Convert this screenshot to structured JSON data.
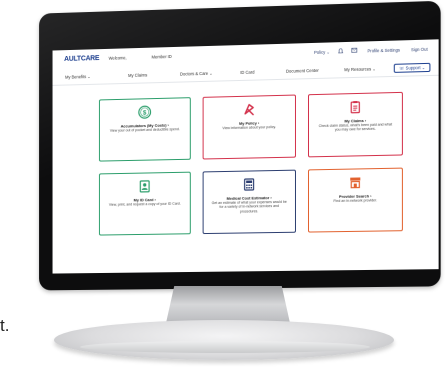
{
  "header": {
    "logo": "AULTCARE",
    "logo_tagline": "",
    "welcome": "Welcome,",
    "member_id": "Member ID",
    "policy_menu": "Policy ⌄",
    "profile_settings": "Profile & Settings",
    "sign_out": "Sign Out"
  },
  "nav": {
    "items": [
      "My Benefits ⌄",
      "My Claims",
      "Doctors & Care ⌄",
      "ID Card",
      "Document Center",
      "My Resources ⌄"
    ],
    "support": "☏ Support ⌄"
  },
  "cards": [
    {
      "title": "Accumulators (My Costs) ›",
      "desc": "View your out of pocket and deductible spend.",
      "color": "#2a9d6a",
      "icon": "dollar-icon"
    },
    {
      "title": "My Policy ›",
      "desc": "View information about your policy.",
      "color": "#d3314b",
      "icon": "policy-icon"
    },
    {
      "title": "My Claims ›",
      "desc": "Check claim status, what's been paid and what you may owe for services.",
      "color": "#d3314b",
      "icon": "clipboard-icon"
    },
    {
      "title": "My ID Card ›",
      "desc": "View, print, and request a copy of your ID Card.",
      "color": "#2a9d6a",
      "icon": "id-card-icon"
    },
    {
      "title": "Medical Cost Estimator ›",
      "desc": "Get an estimate of what your expenses would be for a variety of in-network services and procedures.",
      "color": "#2c3e70",
      "icon": "calculator-icon"
    },
    {
      "title": "Provider Search ›",
      "desc": "Find an in-network provider.",
      "color": "#e2622f",
      "icon": "storefront-icon"
    }
  ],
  "stray_text": "t."
}
